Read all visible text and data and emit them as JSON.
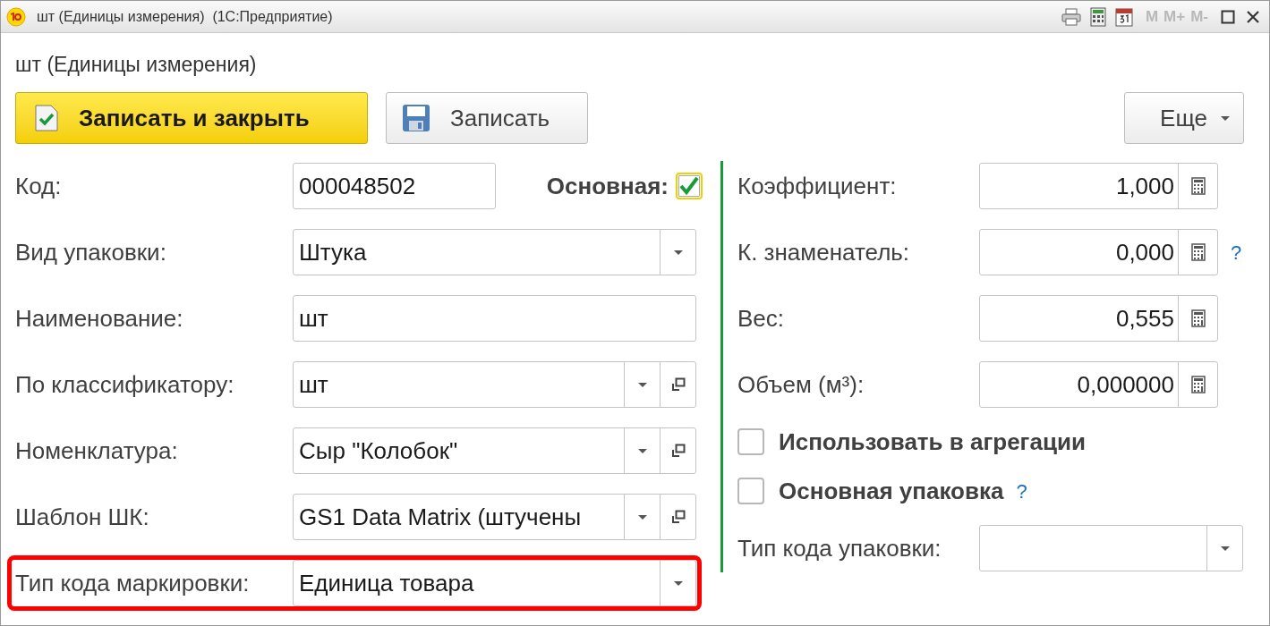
{
  "window": {
    "title": "шт (Единицы измерения)  (1С:Предприятие)",
    "memory_buttons": [
      "M",
      "M+",
      "M-"
    ]
  },
  "form_title": "шт (Единицы измерения)",
  "toolbar": {
    "buttons": [
      {
        "label": "Записать и закрыть",
        "kind": "primary"
      },
      {
        "label": "Записать",
        "kind": "save"
      }
    ],
    "more": "Еще"
  },
  "main_checkbox": {
    "label": "Основная:",
    "checked": true
  },
  "left_fields": [
    {
      "label": "Код:",
      "value": "000048502",
      "kind": "text",
      "highlighted": false
    },
    {
      "label": "Вид упаковки:",
      "value": "Штука",
      "kind": "dropdown",
      "highlighted": false
    },
    {
      "label": "Наименование:",
      "value": "шт",
      "kind": "text",
      "highlighted": false
    },
    {
      "label": "По классификатору:",
      "value": "шт",
      "kind": "dropdown_open",
      "highlighted": false
    },
    {
      "label": "Номенклатура:",
      "value": "Сыр \"Колобок\"",
      "kind": "dropdown_open",
      "highlighted": false
    },
    {
      "label": "Шаблон ШК:",
      "value": "GS1 Data Matrix (штучены",
      "kind": "dropdown_open",
      "highlighted": false
    },
    {
      "label": "Тип кода маркировки:",
      "value": "Единица товара",
      "kind": "dropdown",
      "highlighted": true
    }
  ],
  "right_fields": [
    {
      "label": "Коэффициент:",
      "value": "1,000"
    },
    {
      "label": "К. знаменатель:",
      "value": "0,000",
      "help": "?"
    },
    {
      "label": "Вес:",
      "value": "0,555"
    },
    {
      "label": "Объем (м³):",
      "value": "0,000000"
    }
  ],
  "checkboxes": [
    {
      "label": "Использовать в агрегации",
      "checked": false
    },
    {
      "label": "Основная упаковка",
      "checked": false,
      "help": "?"
    }
  ],
  "package_code_type": {
    "label": "Тип кода упаковки:"
  }
}
